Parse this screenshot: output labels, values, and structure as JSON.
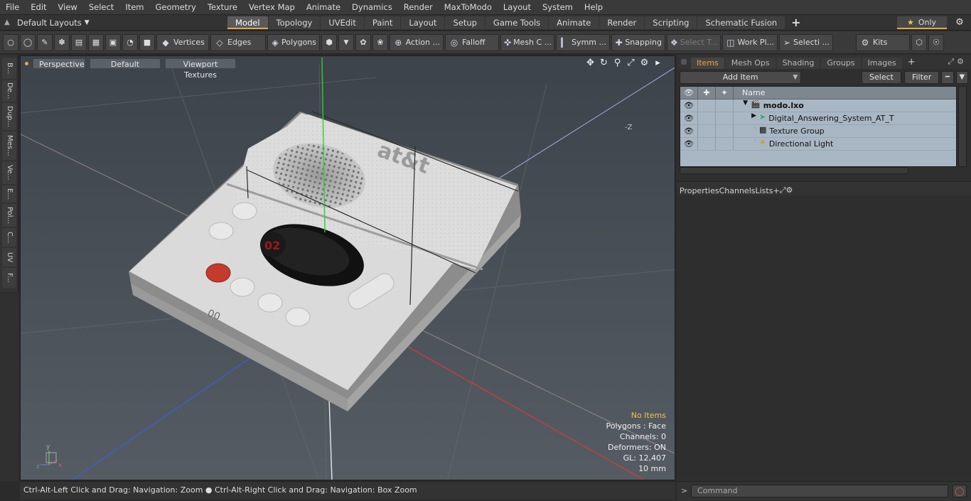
{
  "menu": [
    "File",
    "Edit",
    "View",
    "Select",
    "Item",
    "Geometry",
    "Texture",
    "Vertex Map",
    "Animate",
    "Dynamics",
    "Render",
    "MaxToModo",
    "Layout",
    "System",
    "Help"
  ],
  "layouts": {
    "label": "Default Layouts"
  },
  "tabs": [
    {
      "label": "Model",
      "active": true
    },
    {
      "label": "Topology"
    },
    {
      "label": "UVEdit"
    },
    {
      "label": "Paint"
    },
    {
      "label": "Layout"
    },
    {
      "label": "Setup"
    },
    {
      "label": "Game Tools"
    },
    {
      "label": "Animate"
    },
    {
      "label": "Render"
    },
    {
      "label": "Scripting"
    },
    {
      "label": "Schematic Fusion"
    }
  ],
  "only": "Only",
  "toolbar": {
    "vertices": "Vertices",
    "edges": "Edges",
    "polygons": "Polygons",
    "action": "Action ...",
    "falloff": "Falloff",
    "meshc": "Mesh C ...",
    "symm": "Symm ...",
    "snapping": "Snapping",
    "selectt": "Select T...",
    "workpl": "Work Pl...",
    "selecti": "Selecti ...",
    "kits": "Kits"
  },
  "left_tabs": [
    "B...",
    "De...",
    "Dup...",
    "Mes...",
    "Ve...",
    "E...",
    "Pol...",
    "C...",
    "UV",
    "F..."
  ],
  "viewport": {
    "perspective": "Perspective",
    "default": "Default",
    "textures": "Viewport Textures",
    "axis_label": "-Z",
    "info": {
      "items": "No Items",
      "polygons": "Polygons : Face",
      "channels": "Channels: 0",
      "deformers": "Deformers: ON",
      "gl": "GL: 12,407",
      "scale": "10 mm"
    },
    "model_logo": "at&t"
  },
  "status": "Ctrl-Alt-Left Click and Drag: Navigation: Zoom ● Ctrl-Alt-Right Click and Drag: Navigation: Box Zoom",
  "items_panel": {
    "tabs": [
      {
        "label": "Items",
        "active": true
      },
      {
        "label": "Mesh Ops"
      },
      {
        "label": "Shading"
      },
      {
        "label": "Groups"
      },
      {
        "label": "Images"
      }
    ],
    "add_item": "Add Item",
    "select": "Select",
    "filter": "Filter",
    "name_col": "Name",
    "rows": [
      {
        "label": "modo.lxo",
        "root": true
      },
      {
        "label": "Digital_Answering_System_AT_T"
      },
      {
        "label": "Texture Group"
      },
      {
        "label": "Directional Light"
      }
    ]
  },
  "props_panel": {
    "tabs": [
      {
        "label": "Properties",
        "active": true
      },
      {
        "label": "Channels"
      },
      {
        "label": "Lists"
      }
    ]
  },
  "command": {
    "placeholder": "Command"
  },
  "colors": {
    "accent": "#e4a84b",
    "tree_bg": "#a9b6c3",
    "viewport_bg": "#4c535b"
  }
}
